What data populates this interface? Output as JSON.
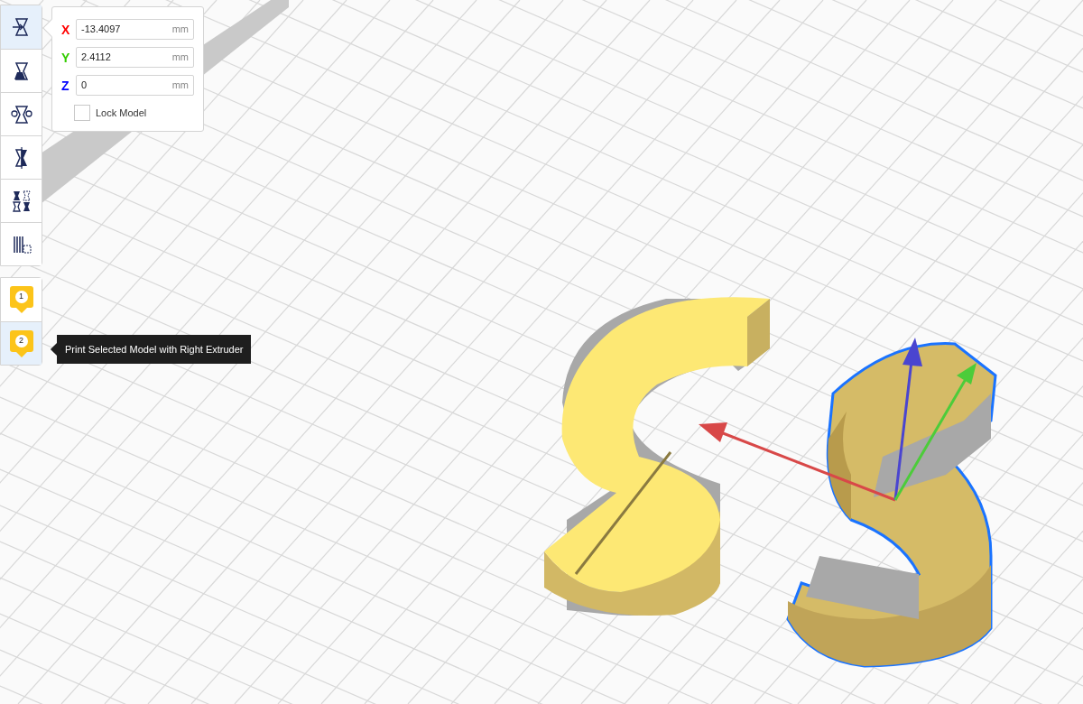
{
  "tools": [
    {
      "kind": "move",
      "selected": true
    },
    {
      "kind": "scale",
      "selected": false
    },
    {
      "kind": "rotate",
      "selected": false
    },
    {
      "kind": "mirror",
      "selected": false
    },
    {
      "kind": "settings",
      "selected": false
    },
    {
      "kind": "blocker",
      "selected": false
    }
  ],
  "extruders": [
    {
      "label": "1",
      "selected": false
    },
    {
      "label": "2",
      "selected": true
    }
  ],
  "position_panel": {
    "fields": [
      {
        "axis": "X",
        "value": "-13.4097",
        "unit": "mm",
        "color": "#ff0000"
      },
      {
        "axis": "Y",
        "value": "2.4112",
        "unit": "mm",
        "color": "#33cc00"
      },
      {
        "axis": "Z",
        "value": "0",
        "unit": "mm",
        "color": "#0000ff"
      }
    ],
    "lock": {
      "label": "Lock Model",
      "checked": false
    }
  },
  "tooltip": "Print Selected Model with Right Extruder"
}
